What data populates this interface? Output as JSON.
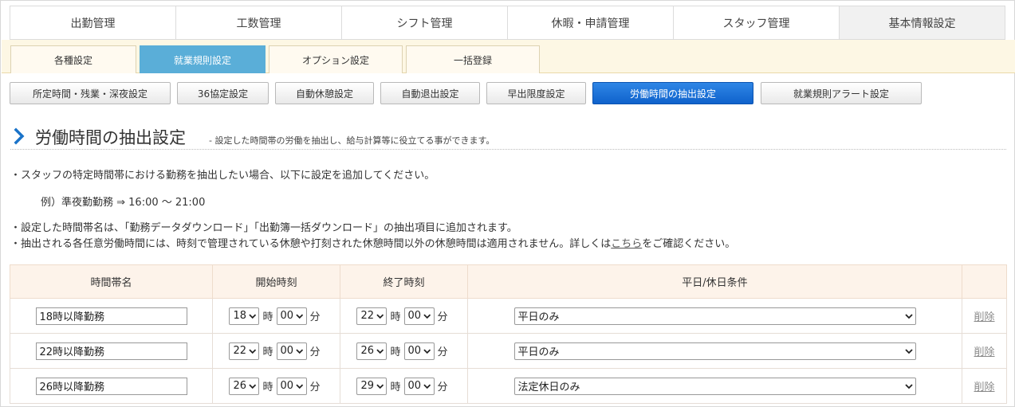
{
  "top_nav": [
    "出勤管理",
    "工数管理",
    "シフト管理",
    "休暇・申請管理",
    "スタッフ管理",
    "基本情報設定"
  ],
  "sub_nav": [
    "各種設定",
    "就業規則設定",
    "オプション設定",
    "一括登録"
  ],
  "rule_buttons": [
    "所定時間・残業・深夜設定",
    "36協定設定",
    "自動休憩設定",
    "自動退出設定",
    "早出限度設定",
    "労働時間の抽出設定",
    "就業規則アラート設定"
  ],
  "active": {
    "top_nav": "基本情報設定",
    "sub_nav": "就業規則設定",
    "rule_button": "労働時間の抽出設定"
  },
  "page": {
    "title": "労働時間の抽出設定",
    "subtitle": "- 設定した時間帯の労働を抽出し、給与計算等に役立てる事ができます。",
    "line1": "・スタッフの特定時間帯における勤務を抽出したい場合、以下に設定を追加してください。",
    "example": "例）準夜勤勤務 ⇒ 16:00 ～ 21:00",
    "line2": "・設定した時間帯名は、「勤務データダウンロード」「出勤簿一括ダウンロード」の抽出項目に追加されます。",
    "line3_pre": "・抽出される各任意労働時間には、時刻で管理されている休憩や打刻された休憩時間以外の休憩時間は適用されません。詳しくは",
    "line3_link": "こちら",
    "line3_post": "をご確認ください。"
  },
  "table": {
    "headers": [
      "時間帯名",
      "開始時刻",
      "終了時刻",
      "平日/休日条件",
      ""
    ],
    "hour_unit": "時",
    "minute_unit": "分",
    "delete_label": "削除",
    "rows": [
      {
        "name": "18時以降勤務",
        "start_h": "18",
        "start_m": "00",
        "end_h": "22",
        "end_m": "00",
        "condition": "平日のみ"
      },
      {
        "name": "22時以降勤務",
        "start_h": "22",
        "start_m": "00",
        "end_h": "26",
        "end_m": "00",
        "condition": "平日のみ"
      },
      {
        "name": "26時以降勤務",
        "start_h": "26",
        "start_m": "00",
        "end_h": "29",
        "end_m": "00",
        "condition": "法定休日のみ"
      }
    ]
  },
  "colors": {
    "active_subtab": "#5aaed8",
    "active_button": "#1a6fd8",
    "subnav_bg": "#fdf7e4",
    "table_header_bg": "#fdf3ea"
  },
  "icons": {
    "title_marker": "chevron-right-icon",
    "select_arrow": "chevron-down-icon"
  }
}
